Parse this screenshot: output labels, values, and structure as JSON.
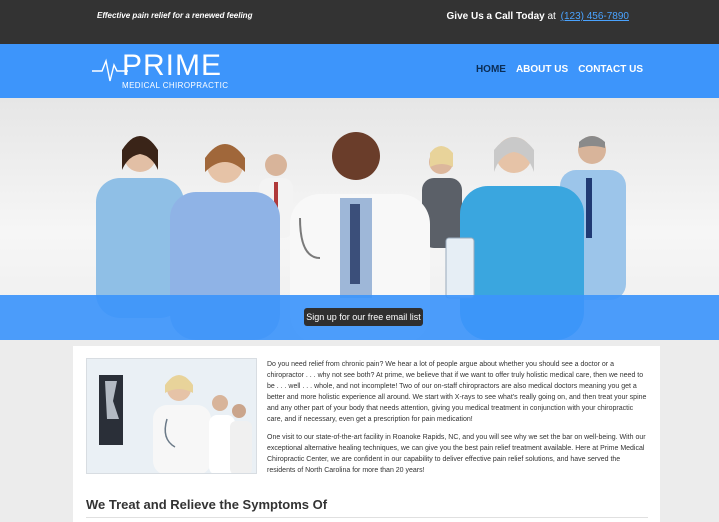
{
  "topbar": {
    "tagline": "Effective pain relief for a renewed feeling",
    "call_label": "Give Us a Call Today",
    "at": "at",
    "phone": "(123) 456-7890"
  },
  "brand": {
    "name": "PRIME",
    "subtitle": "MEDICAL CHIROPRACTIC"
  },
  "nav": {
    "items": [
      "HOME",
      "ABOUT US",
      "CONTACT US"
    ],
    "active": "HOME"
  },
  "hero": {
    "signup_label": "Sign up for our free email list"
  },
  "content": {
    "paragraph1": "Do you need relief from chronic pain?  We hear a lot of people argue about whether you should see a doctor or a chiropractor . . .  why not see both?  At prime, we believe that if we want to offer truly holistic medical care, then we need to be  . . . well . . .  whole, and not incomplete!  Two of our on-staff chiropractors are also medical doctors meaning you get a better and more holistic experience all around.  We start with X-rays to see what's really going on, and then treat your spine and any other part of your body that needs attention, giving you medical treatment in conjunction with your chiropractic care, and if necessary, even get a prescription for pain medication!",
    "paragraph2": "One visit to our state-of-the-art facility in Roanoke Rapids, NC, and you will see why we set the bar on well-being. With our exceptional alternative healing techniques, we can give you the best pain relief treatment available. Here at Prime Medical Chiropractic Center, we are confident in our capability to deliver effective pain relief solutions, and have served the residents of North Carolina for more than 20 years!",
    "heading": "We Treat and Relieve the Symptoms Of"
  },
  "colors": {
    "topbar": "#333333",
    "nav_blue": "#3d95fb",
    "active_nav": "#0b2d55",
    "link": "#4aa3ff"
  }
}
